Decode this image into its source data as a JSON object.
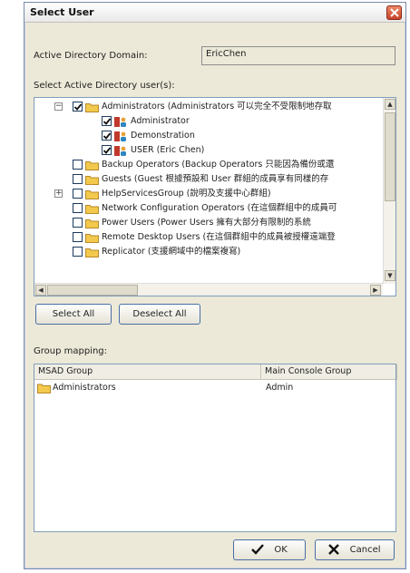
{
  "window": {
    "title": "Select User"
  },
  "domain": {
    "label": "Active Directory Domain:",
    "value": "EricChen"
  },
  "select_label": "Select Active Directory user(s):",
  "tree": [
    {
      "label": "Administrators (Administrators 可以完全不受限制地存取",
      "level": 0,
      "expander": "-",
      "checked": true,
      "icon": "folder-icon"
    },
    {
      "label": "Administrator",
      "level": 1,
      "checked": true,
      "icon": "user-icon"
    },
    {
      "label": "Demonstration",
      "level": 1,
      "checked": true,
      "icon": "user-icon"
    },
    {
      "label": "USER (Eric Chen)",
      "level": 1,
      "checked": true,
      "icon": "user-icon"
    },
    {
      "label": "Backup Operators (Backup Operators 只能因為備份或還",
      "level": 0,
      "checked": false,
      "icon": "folder-icon"
    },
    {
      "label": "Guests (Guest 根據預設和 User 群組的成員享有同樣的存",
      "level": 0,
      "checked": false,
      "icon": "folder-icon"
    },
    {
      "label": "HelpServicesGroup (說明及支援中心群組)",
      "level": 0,
      "expander": "+",
      "checked": false,
      "icon": "folder-icon"
    },
    {
      "label": "Network Configuration Operators (在這個群組中的成員可",
      "level": 0,
      "checked": false,
      "icon": "folder-icon"
    },
    {
      "label": "Power Users (Power Users 擁有大部分有限制的系統",
      "level": 0,
      "checked": false,
      "icon": "folder-icon"
    },
    {
      "label": "Remote Desktop Users (在這個群組中的成員被授權遠端登",
      "level": 0,
      "checked": false,
      "icon": "folder-icon"
    },
    {
      "label": "Replicator (支援網域中的檔案複寫)",
      "level": 0,
      "checked": false,
      "icon": "folder-icon"
    }
  ],
  "buttons": {
    "select_all": "Select All",
    "deselect_all": "Deselect All",
    "ok": "OK",
    "cancel": "Cancel"
  },
  "group_mapping": {
    "label": "Group mapping:",
    "columns": [
      "MSAD Group",
      "Main Console Group"
    ],
    "rows": [
      {
        "msad": "Administrators",
        "console": "Admin"
      }
    ]
  },
  "colors": {
    "accent": "#4a6fa5",
    "close": "#c8442a",
    "folder": "#f2c94c"
  }
}
